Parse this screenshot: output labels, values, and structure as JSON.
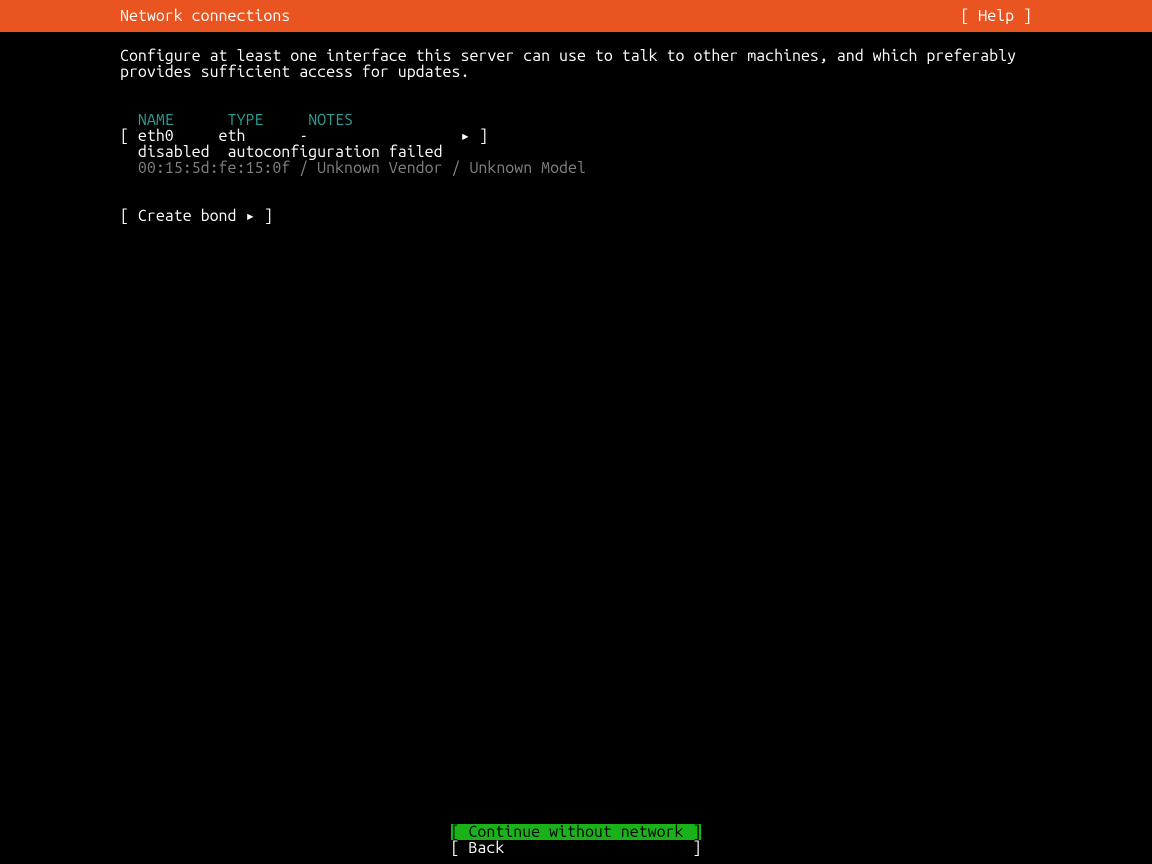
{
  "header": {
    "title": "Network connections",
    "help_label": "[ Help ]"
  },
  "description": "Configure at least one interface this server can use to talk to other machines, and which preferably provides sufficient access for updates.",
  "interfaces": {
    "columns": {
      "name": "NAME",
      "type": "TYPE",
      "notes": "NOTES"
    },
    "rows": [
      {
        "line": "[ eth0     eth      -                 ▸ ]",
        "status": "  disabled  autoconfiguration failed",
        "details": "  00:15:5d:fe:15:0f / Unknown Vendor / Unknown Model"
      }
    ]
  },
  "create_bond_label": "[ Create bond ▸ ]",
  "footer": {
    "continue_label": "[ Continue without network ]",
    "back_label": "[ Back                     ]"
  }
}
